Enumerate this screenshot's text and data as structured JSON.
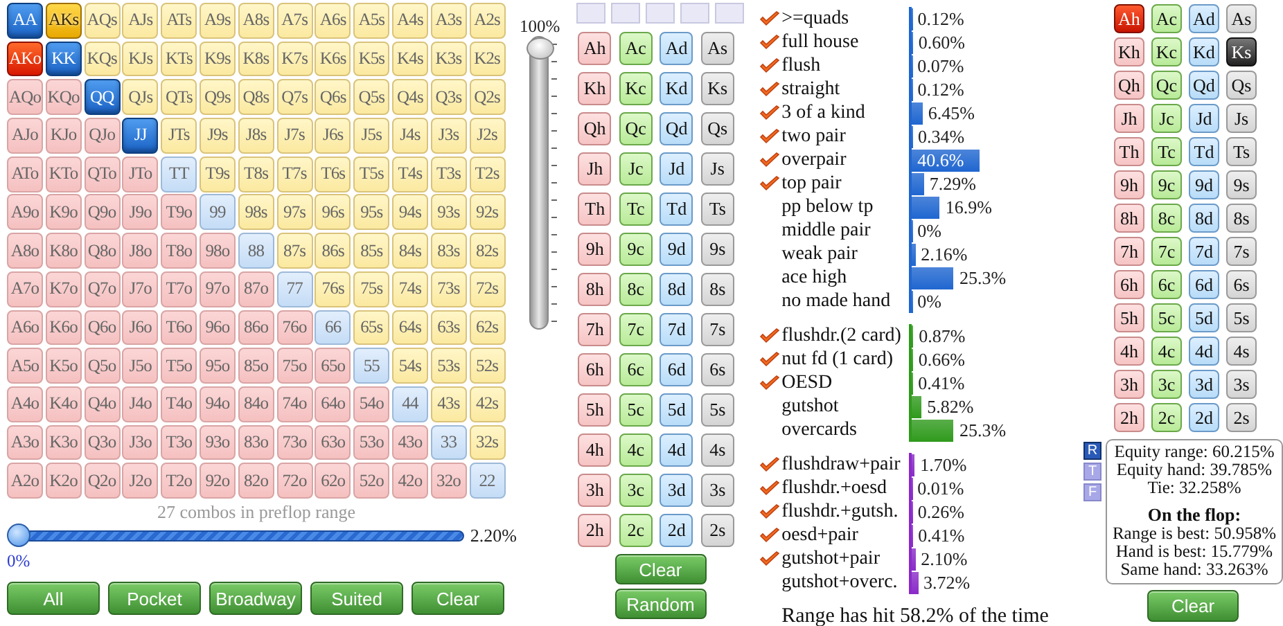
{
  "range_grid": {
    "rows": [
      [
        {
          "label": "AA",
          "kind": "pair",
          "selected": true,
          "partial": false
        },
        {
          "label": "AKs",
          "kind": "suited",
          "selected": true,
          "partial": true
        },
        {
          "label": "AQs",
          "kind": "suited",
          "selected": false,
          "partial": false
        },
        {
          "label": "AJs",
          "kind": "suited",
          "selected": false,
          "partial": false
        },
        {
          "label": "ATs",
          "kind": "suited",
          "selected": false,
          "partial": false
        },
        {
          "label": "A9s",
          "kind": "suited",
          "selected": false,
          "partial": false
        },
        {
          "label": "A8s",
          "kind": "suited",
          "selected": false,
          "partial": false
        },
        {
          "label": "A7s",
          "kind": "suited",
          "selected": false,
          "partial": false
        },
        {
          "label": "A6s",
          "kind": "suited",
          "selected": false,
          "partial": false
        },
        {
          "label": "A5s",
          "kind": "suited",
          "selected": false,
          "partial": false
        },
        {
          "label": "A4s",
          "kind": "suited",
          "selected": false,
          "partial": false
        },
        {
          "label": "A3s",
          "kind": "suited",
          "selected": false,
          "partial": false
        },
        {
          "label": "A2s",
          "kind": "suited",
          "selected": false,
          "partial": false
        }
      ],
      [
        {
          "label": "AKo",
          "kind": "offsuit",
          "selected": true,
          "partial": true
        },
        {
          "label": "KK",
          "kind": "pair",
          "selected": true,
          "partial": false
        },
        {
          "label": "KQs",
          "kind": "suited",
          "selected": false,
          "partial": false
        },
        {
          "label": "KJs",
          "kind": "suited",
          "selected": false,
          "partial": false
        },
        {
          "label": "KTs",
          "kind": "suited",
          "selected": false,
          "partial": false
        },
        {
          "label": "K9s",
          "kind": "suited",
          "selected": false,
          "partial": false
        },
        {
          "label": "K8s",
          "kind": "suited",
          "selected": false,
          "partial": false
        },
        {
          "label": "K7s",
          "kind": "suited",
          "selected": false,
          "partial": false
        },
        {
          "label": "K6s",
          "kind": "suited",
          "selected": false,
          "partial": false
        },
        {
          "label": "K5s",
          "kind": "suited",
          "selected": false,
          "partial": false
        },
        {
          "label": "K4s",
          "kind": "suited",
          "selected": false,
          "partial": false
        },
        {
          "label": "K3s",
          "kind": "suited",
          "selected": false,
          "partial": false
        },
        {
          "label": "K2s",
          "kind": "suited",
          "selected": false,
          "partial": false
        }
      ],
      [
        {
          "label": "AQo",
          "kind": "offsuit",
          "selected": false,
          "partial": false
        },
        {
          "label": "KQo",
          "kind": "offsuit",
          "selected": false,
          "partial": false
        },
        {
          "label": "QQ",
          "kind": "pair",
          "selected": true,
          "partial": false
        },
        {
          "label": "QJs",
          "kind": "suited",
          "selected": false,
          "partial": false
        },
        {
          "label": "QTs",
          "kind": "suited",
          "selected": false,
          "partial": false
        },
        {
          "label": "Q9s",
          "kind": "suited",
          "selected": false,
          "partial": false
        },
        {
          "label": "Q8s",
          "kind": "suited",
          "selected": false,
          "partial": false
        },
        {
          "label": "Q7s",
          "kind": "suited",
          "selected": false,
          "partial": false
        },
        {
          "label": "Q6s",
          "kind": "suited",
          "selected": false,
          "partial": false
        },
        {
          "label": "Q5s",
          "kind": "suited",
          "selected": false,
          "partial": false
        },
        {
          "label": "Q4s",
          "kind": "suited",
          "selected": false,
          "partial": false
        },
        {
          "label": "Q3s",
          "kind": "suited",
          "selected": false,
          "partial": false
        },
        {
          "label": "Q2s",
          "kind": "suited",
          "selected": false,
          "partial": false
        }
      ],
      [
        {
          "label": "AJo",
          "kind": "offsuit",
          "selected": false,
          "partial": false
        },
        {
          "label": "KJo",
          "kind": "offsuit",
          "selected": false,
          "partial": false
        },
        {
          "label": "QJo",
          "kind": "offsuit",
          "selected": false,
          "partial": false
        },
        {
          "label": "JJ",
          "kind": "pair",
          "selected": true,
          "partial": false
        },
        {
          "label": "JTs",
          "kind": "suited",
          "selected": false,
          "partial": false
        },
        {
          "label": "J9s",
          "kind": "suited",
          "selected": false,
          "partial": false
        },
        {
          "label": "J8s",
          "kind": "suited",
          "selected": false,
          "partial": false
        },
        {
          "label": "J7s",
          "kind": "suited",
          "selected": false,
          "partial": false
        },
        {
          "label": "J6s",
          "kind": "suited",
          "selected": false,
          "partial": false
        },
        {
          "label": "J5s",
          "kind": "suited",
          "selected": false,
          "partial": false
        },
        {
          "label": "J4s",
          "kind": "suited",
          "selected": false,
          "partial": false
        },
        {
          "label": "J3s",
          "kind": "suited",
          "selected": false,
          "partial": false
        },
        {
          "label": "J2s",
          "kind": "suited",
          "selected": false,
          "partial": false
        }
      ],
      [
        {
          "label": "ATo",
          "kind": "offsuit",
          "selected": false,
          "partial": false
        },
        {
          "label": "KTo",
          "kind": "offsuit",
          "selected": false,
          "partial": false
        },
        {
          "label": "QTo",
          "kind": "offsuit",
          "selected": false,
          "partial": false
        },
        {
          "label": "JTo",
          "kind": "offsuit",
          "selected": false,
          "partial": false
        },
        {
          "label": "TT",
          "kind": "pair",
          "selected": false,
          "partial": false
        },
        {
          "label": "T9s",
          "kind": "suited",
          "selected": false,
          "partial": false
        },
        {
          "label": "T8s",
          "kind": "suited",
          "selected": false,
          "partial": false
        },
        {
          "label": "T7s",
          "kind": "suited",
          "selected": false,
          "partial": false
        },
        {
          "label": "T6s",
          "kind": "suited",
          "selected": false,
          "partial": false
        },
        {
          "label": "T5s",
          "kind": "suited",
          "selected": false,
          "partial": false
        },
        {
          "label": "T4s",
          "kind": "suited",
          "selected": false,
          "partial": false
        },
        {
          "label": "T3s",
          "kind": "suited",
          "selected": false,
          "partial": false
        },
        {
          "label": "T2s",
          "kind": "suited",
          "selected": false,
          "partial": false
        }
      ],
      [
        {
          "label": "A9o",
          "kind": "offsuit",
          "selected": false,
          "partial": false
        },
        {
          "label": "K9o",
          "kind": "offsuit",
          "selected": false,
          "partial": false
        },
        {
          "label": "Q9o",
          "kind": "offsuit",
          "selected": false,
          "partial": false
        },
        {
          "label": "J9o",
          "kind": "offsuit",
          "selected": false,
          "partial": false
        },
        {
          "label": "T9o",
          "kind": "offsuit",
          "selected": false,
          "partial": false
        },
        {
          "label": "99",
          "kind": "pair",
          "selected": false,
          "partial": false
        },
        {
          "label": "98s",
          "kind": "suited",
          "selected": false,
          "partial": false
        },
        {
          "label": "97s",
          "kind": "suited",
          "selected": false,
          "partial": false
        },
        {
          "label": "96s",
          "kind": "suited",
          "selected": false,
          "partial": false
        },
        {
          "label": "95s",
          "kind": "suited",
          "selected": false,
          "partial": false
        },
        {
          "label": "94s",
          "kind": "suited",
          "selected": false,
          "partial": false
        },
        {
          "label": "93s",
          "kind": "suited",
          "selected": false,
          "partial": false
        },
        {
          "label": "92s",
          "kind": "suited",
          "selected": false,
          "partial": false
        }
      ],
      [
        {
          "label": "A8o",
          "kind": "offsuit",
          "selected": false,
          "partial": false
        },
        {
          "label": "K8o",
          "kind": "offsuit",
          "selected": false,
          "partial": false
        },
        {
          "label": "Q8o",
          "kind": "offsuit",
          "selected": false,
          "partial": false
        },
        {
          "label": "J8o",
          "kind": "offsuit",
          "selected": false,
          "partial": false
        },
        {
          "label": "T8o",
          "kind": "offsuit",
          "selected": false,
          "partial": false
        },
        {
          "label": "98o",
          "kind": "offsuit",
          "selected": false,
          "partial": false
        },
        {
          "label": "88",
          "kind": "pair",
          "selected": false,
          "partial": false
        },
        {
          "label": "87s",
          "kind": "suited",
          "selected": false,
          "partial": false
        },
        {
          "label": "86s",
          "kind": "suited",
          "selected": false,
          "partial": false
        },
        {
          "label": "85s",
          "kind": "suited",
          "selected": false,
          "partial": false
        },
        {
          "label": "84s",
          "kind": "suited",
          "selected": false,
          "partial": false
        },
        {
          "label": "83s",
          "kind": "suited",
          "selected": false,
          "partial": false
        },
        {
          "label": "82s",
          "kind": "suited",
          "selected": false,
          "partial": false
        }
      ],
      [
        {
          "label": "A7o",
          "kind": "offsuit",
          "selected": false,
          "partial": false
        },
        {
          "label": "K7o",
          "kind": "offsuit",
          "selected": false,
          "partial": false
        },
        {
          "label": "Q7o",
          "kind": "offsuit",
          "selected": false,
          "partial": false
        },
        {
          "label": "J7o",
          "kind": "offsuit",
          "selected": false,
          "partial": false
        },
        {
          "label": "T7o",
          "kind": "offsuit",
          "selected": false,
          "partial": false
        },
        {
          "label": "97o",
          "kind": "offsuit",
          "selected": false,
          "partial": false
        },
        {
          "label": "87o",
          "kind": "offsuit",
          "selected": false,
          "partial": false
        },
        {
          "label": "77",
          "kind": "pair",
          "selected": false,
          "partial": false
        },
        {
          "label": "76s",
          "kind": "suited",
          "selected": false,
          "partial": false
        },
        {
          "label": "75s",
          "kind": "suited",
          "selected": false,
          "partial": false
        },
        {
          "label": "74s",
          "kind": "suited",
          "selected": false,
          "partial": false
        },
        {
          "label": "73s",
          "kind": "suited",
          "selected": false,
          "partial": false
        },
        {
          "label": "72s",
          "kind": "suited",
          "selected": false,
          "partial": false
        }
      ],
      [
        {
          "label": "A6o",
          "kind": "offsuit",
          "selected": false,
          "partial": false
        },
        {
          "label": "K6o",
          "kind": "offsuit",
          "selected": false,
          "partial": false
        },
        {
          "label": "Q6o",
          "kind": "offsuit",
          "selected": false,
          "partial": false
        },
        {
          "label": "J6o",
          "kind": "offsuit",
          "selected": false,
          "partial": false
        },
        {
          "label": "T6o",
          "kind": "offsuit",
          "selected": false,
          "partial": false
        },
        {
          "label": "96o",
          "kind": "offsuit",
          "selected": false,
          "partial": false
        },
        {
          "label": "86o",
          "kind": "offsuit",
          "selected": false,
          "partial": false
        },
        {
          "label": "76o",
          "kind": "offsuit",
          "selected": false,
          "partial": false
        },
        {
          "label": "66",
          "kind": "pair",
          "selected": false,
          "partial": false
        },
        {
          "label": "65s",
          "kind": "suited",
          "selected": false,
          "partial": false
        },
        {
          "label": "64s",
          "kind": "suited",
          "selected": false,
          "partial": false
        },
        {
          "label": "63s",
          "kind": "suited",
          "selected": false,
          "partial": false
        },
        {
          "label": "62s",
          "kind": "suited",
          "selected": false,
          "partial": false
        }
      ],
      [
        {
          "label": "A5o",
          "kind": "offsuit",
          "selected": false,
          "partial": false
        },
        {
          "label": "K5o",
          "kind": "offsuit",
          "selected": false,
          "partial": false
        },
        {
          "label": "Q5o",
          "kind": "offsuit",
          "selected": false,
          "partial": false
        },
        {
          "label": "J5o",
          "kind": "offsuit",
          "selected": false,
          "partial": false
        },
        {
          "label": "T5o",
          "kind": "offsuit",
          "selected": false,
          "partial": false
        },
        {
          "label": "95o",
          "kind": "offsuit",
          "selected": false,
          "partial": false
        },
        {
          "label": "85o",
          "kind": "offsuit",
          "selected": false,
          "partial": false
        },
        {
          "label": "75o",
          "kind": "offsuit",
          "selected": false,
          "partial": false
        },
        {
          "label": "65o",
          "kind": "offsuit",
          "selected": false,
          "partial": false
        },
        {
          "label": "55",
          "kind": "pair",
          "selected": false,
          "partial": false
        },
        {
          "label": "54s",
          "kind": "suited",
          "selected": false,
          "partial": false
        },
        {
          "label": "53s",
          "kind": "suited",
          "selected": false,
          "partial": false
        },
        {
          "label": "52s",
          "kind": "suited",
          "selected": false,
          "partial": false
        }
      ],
      [
        {
          "label": "A4o",
          "kind": "offsuit",
          "selected": false,
          "partial": false
        },
        {
          "label": "K4o",
          "kind": "offsuit",
          "selected": false,
          "partial": false
        },
        {
          "label": "Q4o",
          "kind": "offsuit",
          "selected": false,
          "partial": false
        },
        {
          "label": "J4o",
          "kind": "offsuit",
          "selected": false,
          "partial": false
        },
        {
          "label": "T4o",
          "kind": "offsuit",
          "selected": false,
          "partial": false
        },
        {
          "label": "94o",
          "kind": "offsuit",
          "selected": false,
          "partial": false
        },
        {
          "label": "84o",
          "kind": "offsuit",
          "selected": false,
          "partial": false
        },
        {
          "label": "74o",
          "kind": "offsuit",
          "selected": false,
          "partial": false
        },
        {
          "label": "64o",
          "kind": "offsuit",
          "selected": false,
          "partial": false
        },
        {
          "label": "54o",
          "kind": "offsuit",
          "selected": false,
          "partial": false
        },
        {
          "label": "44",
          "kind": "pair",
          "selected": false,
          "partial": false
        },
        {
          "label": "43s",
          "kind": "suited",
          "selected": false,
          "partial": false
        },
        {
          "label": "42s",
          "kind": "suited",
          "selected": false,
          "partial": false
        }
      ],
      [
        {
          "label": "A3o",
          "kind": "offsuit",
          "selected": false,
          "partial": false
        },
        {
          "label": "K3o",
          "kind": "offsuit",
          "selected": false,
          "partial": false
        },
        {
          "label": "Q3o",
          "kind": "offsuit",
          "selected": false,
          "partial": false
        },
        {
          "label": "J3o",
          "kind": "offsuit",
          "selected": false,
          "partial": false
        },
        {
          "label": "T3o",
          "kind": "offsuit",
          "selected": false,
          "partial": false
        },
        {
          "label": "93o",
          "kind": "offsuit",
          "selected": false,
          "partial": false
        },
        {
          "label": "83o",
          "kind": "offsuit",
          "selected": false,
          "partial": false
        },
        {
          "label": "73o",
          "kind": "offsuit",
          "selected": false,
          "partial": false
        },
        {
          "label": "63o",
          "kind": "offsuit",
          "selected": false,
          "partial": false
        },
        {
          "label": "53o",
          "kind": "offsuit",
          "selected": false,
          "partial": false
        },
        {
          "label": "43o",
          "kind": "offsuit",
          "selected": false,
          "partial": false
        },
        {
          "label": "33",
          "kind": "pair",
          "selected": false,
          "partial": false
        },
        {
          "label": "32s",
          "kind": "suited",
          "selected": false,
          "partial": false
        }
      ],
      [
        {
          "label": "A2o",
          "kind": "offsuit",
          "selected": false,
          "partial": false
        },
        {
          "label": "K2o",
          "kind": "offsuit",
          "selected": false,
          "partial": false
        },
        {
          "label": "Q2o",
          "kind": "offsuit",
          "selected": false,
          "partial": false
        },
        {
          "label": "J2o",
          "kind": "offsuit",
          "selected": false,
          "partial": false
        },
        {
          "label": "T2o",
          "kind": "offsuit",
          "selected": false,
          "partial": false
        },
        {
          "label": "92o",
          "kind": "offsuit",
          "selected": false,
          "partial": false
        },
        {
          "label": "82o",
          "kind": "offsuit",
          "selected": false,
          "partial": false
        },
        {
          "label": "72o",
          "kind": "offsuit",
          "selected": false,
          "partial": false
        },
        {
          "label": "62o",
          "kind": "offsuit",
          "selected": false,
          "partial": false
        },
        {
          "label": "52o",
          "kind": "offsuit",
          "selected": false,
          "partial": false
        },
        {
          "label": "42o",
          "kind": "offsuit",
          "selected": false,
          "partial": false
        },
        {
          "label": "32o",
          "kind": "offsuit",
          "selected": false,
          "partial": false
        },
        {
          "label": "22",
          "kind": "pair",
          "selected": false,
          "partial": false
        }
      ]
    ]
  },
  "range_slider": {
    "caption": "27 combos in preflop range",
    "value": "2.20%",
    "min_label": "0%",
    "level": 0
  },
  "equity_slider": {
    "label": "100%",
    "level": 1
  },
  "range_buttons": [
    "All",
    "Pocket",
    "Broadway",
    "Suited",
    "Clear"
  ],
  "board_deck": {
    "rows": [
      [
        {
          "label": "Ah",
          "kind": "hearts",
          "selected": false
        },
        {
          "label": "Ac",
          "kind": "clubs",
          "selected": false
        },
        {
          "label": "Ad",
          "kind": "diamonds",
          "selected": false
        },
        {
          "label": "As",
          "kind": "spades",
          "selected": false
        }
      ],
      [
        {
          "label": "Kh",
          "kind": "hearts",
          "selected": false
        },
        {
          "label": "Kc",
          "kind": "clubs",
          "selected": false
        },
        {
          "label": "Kd",
          "kind": "diamonds",
          "selected": false
        },
        {
          "label": "Ks",
          "kind": "spades",
          "selected": false
        }
      ],
      [
        {
          "label": "Qh",
          "kind": "hearts",
          "selected": false
        },
        {
          "label": "Qc",
          "kind": "clubs",
          "selected": false
        },
        {
          "label": "Qd",
          "kind": "diamonds",
          "selected": false
        },
        {
          "label": "Qs",
          "kind": "spades",
          "selected": false
        }
      ],
      [
        {
          "label": "Jh",
          "kind": "hearts",
          "selected": false
        },
        {
          "label": "Jc",
          "kind": "clubs",
          "selected": false
        },
        {
          "label": "Jd",
          "kind": "diamonds",
          "selected": false
        },
        {
          "label": "Js",
          "kind": "spades",
          "selected": false
        }
      ],
      [
        {
          "label": "Th",
          "kind": "hearts",
          "selected": false
        },
        {
          "label": "Tc",
          "kind": "clubs",
          "selected": false
        },
        {
          "label": "Td",
          "kind": "diamonds",
          "selected": false
        },
        {
          "label": "Ts",
          "kind": "spades",
          "selected": false
        }
      ],
      [
        {
          "label": "9h",
          "kind": "hearts",
          "selected": false
        },
        {
          "label": "9c",
          "kind": "clubs",
          "selected": false
        },
        {
          "label": "9d",
          "kind": "diamonds",
          "selected": false
        },
        {
          "label": "9s",
          "kind": "spades",
          "selected": false
        }
      ],
      [
        {
          "label": "8h",
          "kind": "hearts",
          "selected": false
        },
        {
          "label": "8c",
          "kind": "clubs",
          "selected": false
        },
        {
          "label": "8d",
          "kind": "diamonds",
          "selected": false
        },
        {
          "label": "8s",
          "kind": "spades",
          "selected": false
        }
      ],
      [
        {
          "label": "7h",
          "kind": "hearts",
          "selected": false
        },
        {
          "label": "7c",
          "kind": "clubs",
          "selected": false
        },
        {
          "label": "7d",
          "kind": "diamonds",
          "selected": false
        },
        {
          "label": "7s",
          "kind": "spades",
          "selected": false
        }
      ],
      [
        {
          "label": "6h",
          "kind": "hearts",
          "selected": false
        },
        {
          "label": "6c",
          "kind": "clubs",
          "selected": false
        },
        {
          "label": "6d",
          "kind": "diamonds",
          "selected": false
        },
        {
          "label": "6s",
          "kind": "spades",
          "selected": false
        }
      ],
      [
        {
          "label": "5h",
          "kind": "hearts",
          "selected": false
        },
        {
          "label": "5c",
          "kind": "clubs",
          "selected": false
        },
        {
          "label": "5d",
          "kind": "diamonds",
          "selected": false
        },
        {
          "label": "5s",
          "kind": "spades",
          "selected": false
        }
      ],
      [
        {
          "label": "4h",
          "kind": "hearts",
          "selected": false
        },
        {
          "label": "4c",
          "kind": "clubs",
          "selected": false
        },
        {
          "label": "4d",
          "kind": "diamonds",
          "selected": false
        },
        {
          "label": "4s",
          "kind": "spades",
          "selected": false
        }
      ],
      [
        {
          "label": "3h",
          "kind": "hearts",
          "selected": false
        },
        {
          "label": "3c",
          "kind": "clubs",
          "selected": false
        },
        {
          "label": "3d",
          "kind": "diamonds",
          "selected": false
        },
        {
          "label": "3s",
          "kind": "spades",
          "selected": false
        }
      ],
      [
        {
          "label": "2h",
          "kind": "hearts",
          "selected": false
        },
        {
          "label": "2c",
          "kind": "clubs",
          "selected": false
        },
        {
          "label": "2d",
          "kind": "diamonds",
          "selected": false
        },
        {
          "label": "2s",
          "kind": "spades",
          "selected": false
        }
      ]
    ],
    "buttons": [
      "Clear",
      "Random"
    ]
  },
  "stats": {
    "sections": [
      {
        "kind": "made",
        "items": [
          {
            "label": ">=quads",
            "checked": true,
            "value": "0.12%",
            "level": 0.0012
          },
          {
            "label": "full house",
            "checked": true,
            "value": "0.60%",
            "level": 0.006
          },
          {
            "label": "flush",
            "checked": true,
            "value": "0.07%",
            "level": 0.0007
          },
          {
            "label": "straight",
            "checked": true,
            "value": "0.12%",
            "level": 0.0012
          },
          {
            "label": "3 of a kind",
            "checked": true,
            "value": "6.45%",
            "level": 0.0645
          },
          {
            "label": "two pair",
            "checked": true,
            "value": "0.34%",
            "level": 0.0034
          },
          {
            "label": "overpair",
            "checked": true,
            "value": "40.6%",
            "level": 0.406
          },
          {
            "label": "top pair",
            "checked": true,
            "value": "7.29%",
            "level": 0.0729
          },
          {
            "label": "pp below tp",
            "checked": false,
            "value": "16.9%",
            "level": 0.169
          },
          {
            "label": "middle pair",
            "checked": false,
            "value": "0%",
            "level": 0
          },
          {
            "label": "weak pair",
            "checked": false,
            "value": "2.16%",
            "level": 0.0216
          },
          {
            "label": "ace high",
            "checked": false,
            "value": "25.3%",
            "level": 0.253
          },
          {
            "label": "no made hand",
            "checked": false,
            "value": "0%",
            "level": 0
          }
        ]
      },
      {
        "kind": "draw",
        "items": [
          {
            "label": "flushdr.(2 card)",
            "checked": true,
            "value": "0.87%",
            "level": 0.0087
          },
          {
            "label": "nut fd (1 card)",
            "checked": true,
            "value": "0.66%",
            "level": 0.0066
          },
          {
            "label": "OESD",
            "checked": true,
            "value": "0.41%",
            "level": 0.0041
          },
          {
            "label": "gutshot",
            "checked": false,
            "value": "5.82%",
            "level": 0.0582
          },
          {
            "label": "overcards",
            "checked": false,
            "value": "25.3%",
            "level": 0.253
          }
        ]
      },
      {
        "kind": "combo",
        "items": [
          {
            "label": "flushdraw+pair",
            "checked": true,
            "value": "1.70%",
            "level": 0.017
          },
          {
            "label": "flushdr.+oesd",
            "checked": true,
            "value": "0.01%",
            "level": 0.0001
          },
          {
            "label": "flushdr.+gutsh.",
            "checked": true,
            "value": "0.26%",
            "level": 0.0026
          },
          {
            "label": "oesd+pair",
            "checked": true,
            "value": "0.41%",
            "level": 0.0041
          },
          {
            "label": "gutshot+pair",
            "checked": true,
            "value": "2.10%",
            "level": 0.021
          },
          {
            "label": "gutshot+overc.",
            "checked": false,
            "value": "3.72%",
            "level": 0.0372
          }
        ]
      }
    ],
    "summary": "Range has hit 58.2% of the time"
  },
  "hand_deck": {
    "rows": [
      [
        {
          "label": "Ah",
          "kind": "hearts",
          "selected": true
        },
        {
          "label": "Ac",
          "kind": "clubs",
          "selected": false
        },
        {
          "label": "Ad",
          "kind": "diamonds",
          "selected": false
        },
        {
          "label": "As",
          "kind": "spades",
          "selected": false
        }
      ],
      [
        {
          "label": "Kh",
          "kind": "hearts",
          "selected": false
        },
        {
          "label": "Kc",
          "kind": "clubs",
          "selected": false
        },
        {
          "label": "Kd",
          "kind": "diamonds",
          "selected": false
        },
        {
          "label": "Ks",
          "kind": "spades",
          "selected": true
        }
      ],
      [
        {
          "label": "Qh",
          "kind": "hearts",
          "selected": false
        },
        {
          "label": "Qc",
          "kind": "clubs",
          "selected": false
        },
        {
          "label": "Qd",
          "kind": "diamonds",
          "selected": false
        },
        {
          "label": "Qs",
          "kind": "spades",
          "selected": false
        }
      ],
      [
        {
          "label": "Jh",
          "kind": "hearts",
          "selected": false
        },
        {
          "label": "Jc",
          "kind": "clubs",
          "selected": false
        },
        {
          "label": "Jd",
          "kind": "diamonds",
          "selected": false
        },
        {
          "label": "Js",
          "kind": "spades",
          "selected": false
        }
      ],
      [
        {
          "label": "Th",
          "kind": "hearts",
          "selected": false
        },
        {
          "label": "Tc",
          "kind": "clubs",
          "selected": false
        },
        {
          "label": "Td",
          "kind": "diamonds",
          "selected": false
        },
        {
          "label": "Ts",
          "kind": "spades",
          "selected": false
        }
      ],
      [
        {
          "label": "9h",
          "kind": "hearts",
          "selected": false
        },
        {
          "label": "9c",
          "kind": "clubs",
          "selected": false
        },
        {
          "label": "9d",
          "kind": "diamonds",
          "selected": false
        },
        {
          "label": "9s",
          "kind": "spades",
          "selected": false
        }
      ],
      [
        {
          "label": "8h",
          "kind": "hearts",
          "selected": false
        },
        {
          "label": "8c",
          "kind": "clubs",
          "selected": false
        },
        {
          "label": "8d",
          "kind": "diamonds",
          "selected": false
        },
        {
          "label": "8s",
          "kind": "spades",
          "selected": false
        }
      ],
      [
        {
          "label": "7h",
          "kind": "hearts",
          "selected": false
        },
        {
          "label": "7c",
          "kind": "clubs",
          "selected": false
        },
        {
          "label": "7d",
          "kind": "diamonds",
          "selected": false
        },
        {
          "label": "7s",
          "kind": "spades",
          "selected": false
        }
      ],
      [
        {
          "label": "6h",
          "kind": "hearts",
          "selected": false
        },
        {
          "label": "6c",
          "kind": "clubs",
          "selected": false
        },
        {
          "label": "6d",
          "kind": "diamonds",
          "selected": false
        },
        {
          "label": "6s",
          "kind": "spades",
          "selected": false
        }
      ],
      [
        {
          "label": "5h",
          "kind": "hearts",
          "selected": false
        },
        {
          "label": "5c",
          "kind": "clubs",
          "selected": false
        },
        {
          "label": "5d",
          "kind": "diamonds",
          "selected": false
        },
        {
          "label": "5s",
          "kind": "spades",
          "selected": false
        }
      ],
      [
        {
          "label": "4h",
          "kind": "hearts",
          "selected": false
        },
        {
          "label": "4c",
          "kind": "clubs",
          "selected": false
        },
        {
          "label": "4d",
          "kind": "diamonds",
          "selected": false
        },
        {
          "label": "4s",
          "kind": "spades",
          "selected": false
        }
      ],
      [
        {
          "label": "3h",
          "kind": "hearts",
          "selected": false
        },
        {
          "label": "3c",
          "kind": "clubs",
          "selected": false
        },
        {
          "label": "3d",
          "kind": "diamonds",
          "selected": false
        },
        {
          "label": "3s",
          "kind": "spades",
          "selected": false
        }
      ],
      [
        {
          "label": "2h",
          "kind": "hearts",
          "selected": false
        },
        {
          "label": "2c",
          "kind": "clubs",
          "selected": false
        },
        {
          "label": "2d",
          "kind": "diamonds",
          "selected": false
        },
        {
          "label": "2s",
          "kind": "spades",
          "selected": false
        }
      ]
    ],
    "views": [
      {
        "label": "R",
        "selected": true
      },
      {
        "label": "T",
        "selected": false
      },
      {
        "label": "F",
        "selected": false
      }
    ],
    "equity_lines": [
      "Equity range: 60.215%",
      "Equity hand: 39.785%",
      "Tie: 32.258%"
    ],
    "flop_heading": "On the flop:",
    "flop_lines": [
      "Range is best: 50.958%",
      "Hand is best: 15.779%",
      "Same hand: 33.263%"
    ],
    "buttons": [
      "Clear"
    ]
  }
}
